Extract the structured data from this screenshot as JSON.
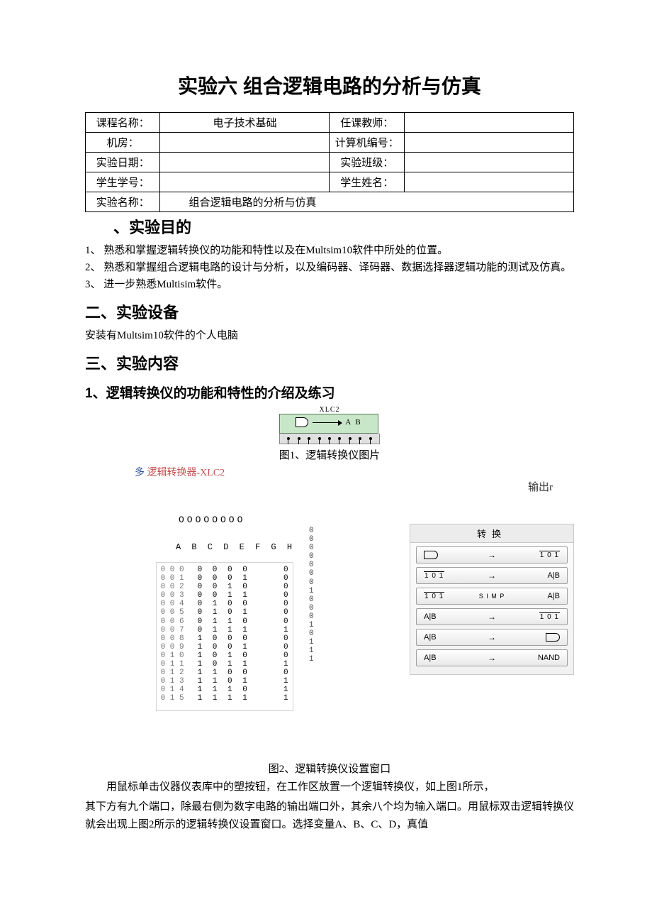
{
  "title": "实验六 组合逻辑电路的分析与仿真",
  "info_table": {
    "r1c1": "课程名称：",
    "r1c2": "电子技术基础",
    "r1c3": "任课教师：",
    "r1c4": "",
    "r2c1": "机房：",
    "r2c2": "",
    "r2c3": "计算机编号：",
    "r2c4": "",
    "r3c1": "实验日期：",
    "r3c2": "",
    "r3c3": "实验班级：",
    "r3c4": "",
    "r4c1": "学生学号：",
    "r4c2": "",
    "r4c3": "学生姓名：",
    "r4c4": "",
    "r5c1": "实验名称：",
    "r5c2": "组合逻辑电路的分析与仿真"
  },
  "sec1_heading": "、实验目的",
  "sec1_items": {
    "a": "1、 熟悉和掌握逻辑转换仪的功能和特性以及在Multsim10软件中所处的位置。",
    "b": "2、 熟悉和掌握组合逻辑电路的设计与分析，以及编码器、译码器、数据选择器逻辑功能的测试及仿真。",
    "c": "3、 进一步熟悉Multisim软件。"
  },
  "sec2_heading": "二、实验设备",
  "sec2_body": "安装有Multsim10软件的个人电脑",
  "sec3_heading": "三、实验内容",
  "sec3_sub1": "1、逻辑转换仪的功能和特性的介绍及练习",
  "fig1_top_label": "XLC2",
  "fig1_ab": "A B",
  "fig1_caption": "图1、逻辑转换仪图片",
  "fig2_title": "逻辑转换器-XLC2",
  "fig2_output_label": "输出r",
  "fig2_oooo": "OOOOOOOO",
  "fig2_abch": "A B C D E F G H",
  "truth_rows": [
    {
      "idx": "0 0 0",
      "bits": "0 0 0 0",
      "out": "0"
    },
    {
      "idx": "0 0 1",
      "bits": "0 0 0 1",
      "out": "0"
    },
    {
      "idx": "0 0 2",
      "bits": "0 0 1 0",
      "out": "0"
    },
    {
      "idx": "0 0 3",
      "bits": "0 0 1 1",
      "out": "0"
    },
    {
      "idx": "0 0 4",
      "bits": "0 1 0 0",
      "out": "0"
    },
    {
      "idx": "0 0 5",
      "bits": "0 1 0 1",
      "out": "0"
    },
    {
      "idx": "0 0 6",
      "bits": "0 1 1 0",
      "out": "0"
    },
    {
      "idx": "0 0 7",
      "bits": "0 1 1 1",
      "out": "1"
    },
    {
      "idx": "0 0 8",
      "bits": "1 0 0 0",
      "out": "0"
    },
    {
      "idx": "0 0 9",
      "bits": "1 0 0 1",
      "out": "0"
    },
    {
      "idx": "0 1 0",
      "bits": "1 0 1 0",
      "out": "0"
    },
    {
      "idx": "0 1 1",
      "bits": "1 0 1 1",
      "out": "1"
    },
    {
      "idx": "0 1 2",
      "bits": "1 1 0 0",
      "out": "0"
    },
    {
      "idx": "0 1 3",
      "bits": "1 1 0 1",
      "out": "1"
    },
    {
      "idx": "0 1 4",
      "bits": "1 1 1 0",
      "out": "1"
    },
    {
      "idx": "0 1 5",
      "bits": "1 1 1 1",
      "out": "1"
    }
  ],
  "extra_col": "0\n0\n0\n0\n0\n0\n0\n1\n0\n0\n0\n1\n0\n1\n1\n1",
  "conv_header": "转换",
  "conv_101": "1 0 1",
  "conv_aib": "A|B",
  "conv_simp": "S I M P",
  "conv_nand": "NAND",
  "fig2_caption": "图2、逻辑转换仪设置窗口",
  "para1": "用鼠标单击仪器仪表库中的塑按钮，在工作区放置一个逻辑转换仪，如上图1所示，",
  "para2": "其下方有九个端口，除最右侧为数字电路的输出端口外，其余八个均为输入端口。用鼠标双击逻辑转换仪就会出现上图2所示的逻辑转换仪设置窗口。选择变量A、B、C、D，真值"
}
